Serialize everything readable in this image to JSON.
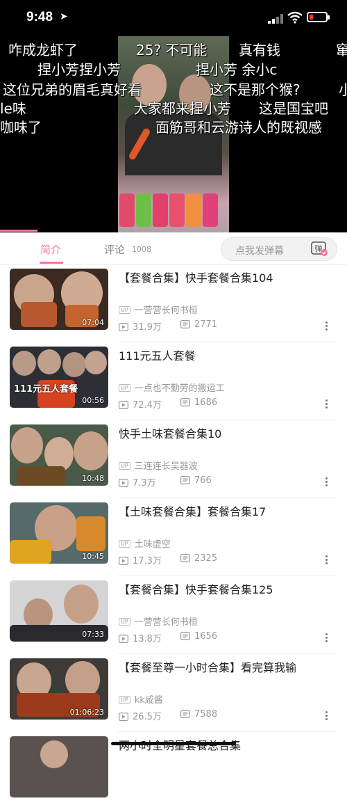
{
  "status_bar": {
    "time": "9:48"
  },
  "danmaku": [
    "咋成龙虾了",
    "25? 不可能",
    "真有钱",
    "窜",
    "捏小芳捏小芳",
    "捏小芳  余小c",
    "这位兄弟的眉毛真好看",
    "这不是那个猴?",
    "小",
    "le味",
    "大家都来捏小芳",
    "这是国宝吧",
    "咖味了",
    "面筋哥和云游诗人的既视感"
  ],
  "tabs": {
    "intro": "简介",
    "comments": "评论",
    "comments_count": "1008",
    "danmaku_placeholder": "点我发弹幕",
    "danmaku_toggle_label": "弹"
  },
  "up_badge": "UP",
  "videos": [
    {
      "title": "【套餐合集】快手套餐合集104",
      "uploader": "一营营长何书桓",
      "views": "31.9万",
      "danmaku": "2771",
      "duration": "07:04",
      "overlay": ""
    },
    {
      "title": "111元五人套餐",
      "uploader": "一点也不勤劳的搬运工",
      "views": "72.4万",
      "danmaku": "1686",
      "duration": "00:56",
      "overlay": "111元五人套餐"
    },
    {
      "title": "快手土味套餐合集10",
      "uploader": "三连连长吴器波",
      "views": "7.3万",
      "danmaku": "766",
      "duration": "10:48",
      "overlay": ""
    },
    {
      "title": "【土味套餐合集】套餐合集17",
      "uploader": "土味虚空",
      "views": "17.3万",
      "danmaku": "2325",
      "duration": "10:45",
      "overlay": ""
    },
    {
      "title": "【套餐合集】快手套餐合集125",
      "uploader": "一营营长何书桓",
      "views": "13.8万",
      "danmaku": "1656",
      "duration": "07:33",
      "overlay": ""
    },
    {
      "title": "【套餐至尊一小时合集】看完算我输",
      "uploader": "kk咸酱",
      "views": "26.5万",
      "danmaku": "7588",
      "duration": "01:06:23",
      "overlay": ""
    },
    {
      "title": "两小时全明星套餐总合集",
      "uploader": "",
      "views": "",
      "danmaku": "",
      "duration": "",
      "overlay": ""
    }
  ],
  "colors": {
    "accent": "#fb7299",
    "text": "#222222",
    "muted": "#999999"
  }
}
